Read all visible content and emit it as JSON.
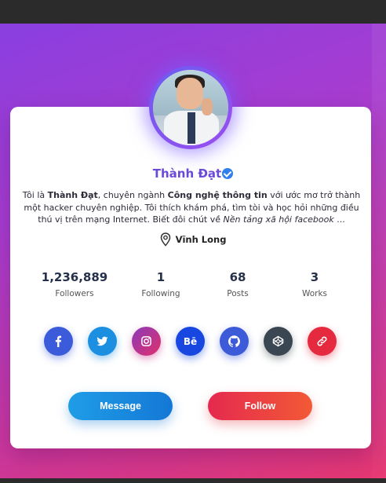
{
  "profile": {
    "name": "Thành Đạt",
    "bio": {
      "p1": "Tôi là ",
      "name_bold": "Thành Đạt",
      "p2": ", chuyên ngành ",
      "field_bold": "Công nghệ thông tin",
      "p3": " với ước mơ trở thành một hacker chuyên nghiệp. Tôi thích khám phá, tìm tòi và học hỏi những điều thú vị trên mạng Internet. Biết đôi chút về ",
      "italic": "Nền tảng xã hội facebook",
      "p4": " ..."
    },
    "location": "Vĩnh Long"
  },
  "stats": [
    {
      "value": "1,236,889",
      "label": "Followers"
    },
    {
      "value": "1",
      "label": "Following"
    },
    {
      "value": "68",
      "label": "Posts"
    },
    {
      "value": "3",
      "label": "Works"
    }
  ],
  "socials": [
    {
      "name": "facebook",
      "icon": "facebook-icon",
      "color": "#3b5bdb"
    },
    {
      "name": "twitter",
      "icon": "twitter-icon",
      "color": "#1d8fe0"
    },
    {
      "name": "instagram",
      "icon": "instagram-icon",
      "color": "#c13584"
    },
    {
      "name": "behance",
      "icon": "behance-icon",
      "label": "Bē",
      "color": "#1747e0"
    },
    {
      "name": "github",
      "icon": "github-icon",
      "color": "#3d5bd9"
    },
    {
      "name": "codepen",
      "icon": "codepen-icon",
      "color": "#3b4653"
    },
    {
      "name": "link",
      "icon": "link-icon",
      "color": "#e5293f"
    }
  ],
  "buttons": {
    "message": "Message",
    "follow": "Follow"
  },
  "colors": {
    "accent": "#6a4ad6",
    "verified": "#2f80ed"
  }
}
